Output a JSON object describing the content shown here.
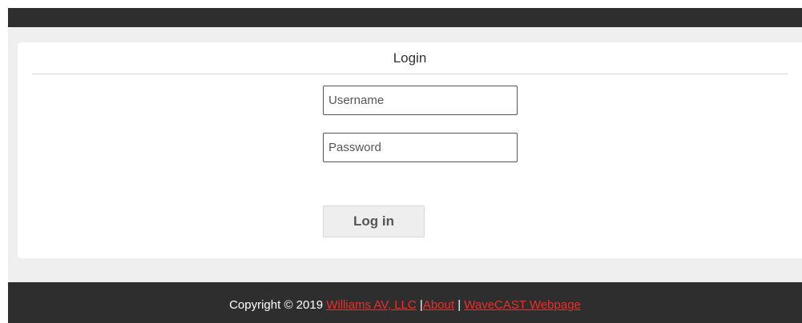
{
  "login": {
    "title": "Login",
    "username_placeholder": "Username",
    "password_placeholder": "Password",
    "submit_label": "Log in"
  },
  "footer": {
    "copyright": "Copyright © 2019 ",
    "company_link": "Williams AV, LLC",
    "separator_1": " |",
    "about_link": "About",
    "separator_2": " | ",
    "webpage_link": "WaveCAST Webpage"
  },
  "colors": {
    "header_footer_bg": "#2e2e2e",
    "link": "#e8302c",
    "panel_bg": "#efefef"
  }
}
